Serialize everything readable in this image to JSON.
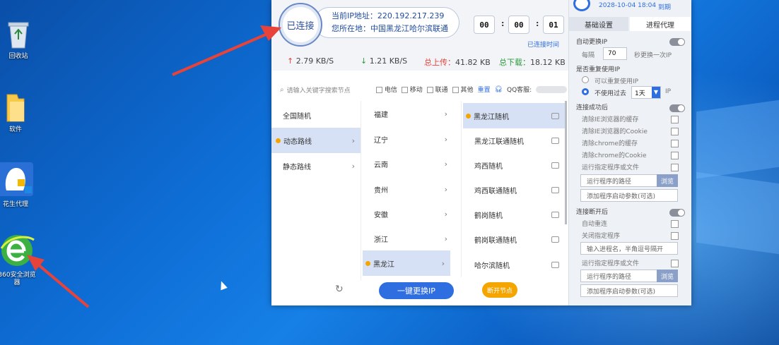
{
  "desktop": {
    "icons": [
      {
        "label": "回收站"
      },
      {
        "label": "软件"
      },
      {
        "label": "花生代理"
      },
      {
        "label": "360安全浏览器"
      }
    ]
  },
  "app": {
    "status_label": "已连接",
    "ip_line": "当前IP地址：220.192.217.239",
    "location_line": "您所在地：中国黑龙江哈尔滨联通",
    "timer": {
      "h": "00",
      "m": "00",
      "s": "01",
      "label": "已连接时间"
    },
    "upload_speed": "2.79 KB/S",
    "download_speed": "1.21 KB/S",
    "total_upload_label": "总上传：",
    "total_upload_value": "41.82 KB",
    "total_download_label": "总下载：",
    "total_download_value": "18.12 KB",
    "search_placeholder": "请输入关键字搜索节点",
    "filters": [
      "电信",
      "移动",
      "联通",
      "其他"
    ],
    "reset_label": "重置",
    "qq_label": "QQ客服:",
    "categories": [
      {
        "label": "全国随机"
      },
      {
        "label": "动态路线"
      },
      {
        "label": "静态路线"
      }
    ],
    "provinces": [
      "福建",
      "辽宁",
      "云南",
      "贵州",
      "安徽",
      "浙江",
      "黑龙江"
    ],
    "nodes": [
      "黑龙江随机",
      "黑龙江联通随机",
      "鸡西随机",
      "鸡西联通随机",
      "鹤岗随机",
      "鹤岗联通随机",
      "哈尔滨随机"
    ],
    "change_ip_button": "一键更换IP",
    "disconnect_button": "断开节点",
    "header_date": "2028-10-04 18:04",
    "header_expire": "到期",
    "tabs": [
      "基础设置",
      "进程代理"
    ],
    "settings": {
      "auto_change_label": "自动更换IP",
      "every_label": "每隔",
      "every_value": "70",
      "every_suffix": "秒更换一次IP",
      "reuse_label": "是否重复使用IP",
      "reuse_opt1": "可以重复使用IP",
      "reuse_opt2": "不使用过去",
      "reuse_days": "1天",
      "reuse_suffix": "IP",
      "after_connect_label": "连接成功后",
      "after_connect_items": [
        "清除IE浏览器的缓存",
        "清除IE浏览器的Cookie",
        "清除chrome的缓存",
        "清除chrome的Cookie",
        "运行指定程序或文件"
      ],
      "run_path_placeholder": "运行程序的路径",
      "browse_label": "浏览",
      "params_placeholder": "添加程序启动参数(可选)",
      "after_disconnect_label": "连接断开后",
      "auto_reconnect": "自动重连",
      "close_program": "关闭指定程序",
      "process_placeholder": "输入进程名，半角逗号隔开",
      "run_file": "运行指定程序或文件",
      "run_path_placeholder2": "运行程序的路径",
      "browse_label2": "浏览",
      "params_placeholder2": "添加程序启动参数(可选)"
    }
  },
  "colors": {
    "desktop": "#0e6ed6",
    "accent": "#2f6ee0",
    "orange": "#f5a500",
    "arrow": "#e8433a"
  }
}
